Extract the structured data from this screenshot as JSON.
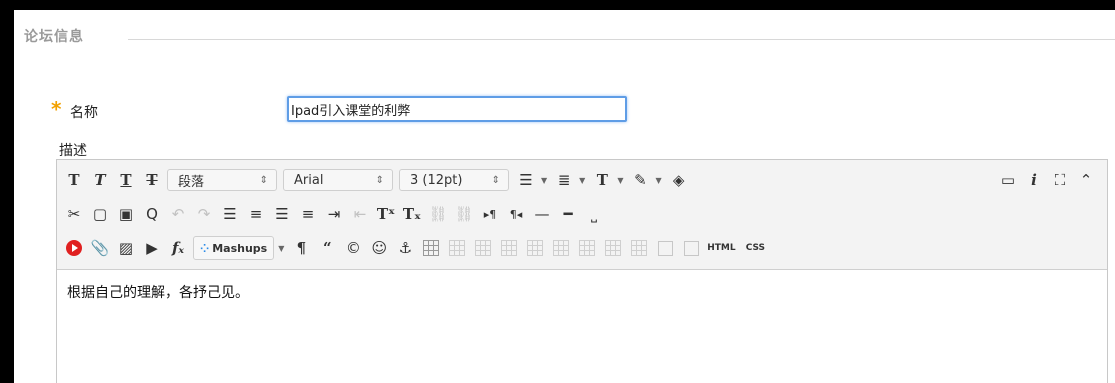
{
  "fieldset": {
    "title": "论坛信息"
  },
  "form": {
    "required_mark": "*",
    "name_label": "名称",
    "name_value": "Ipad引入课堂的利弊",
    "desc_label": "描述"
  },
  "toolbar": {
    "row1": {
      "format_select": "段落",
      "font_select": "Arial",
      "size_select": "3 (12pt)"
    },
    "row3": {
      "mashups_label": "Mashups",
      "html_label": "HTML",
      "css_label": "CSS"
    }
  },
  "editor": {
    "content": "根据自己的理解，各抒己见。"
  },
  "icons": {
    "row1_left": [
      "bold-t-icon",
      "italic-t-icon",
      "underline-t-icon",
      "strikethrough-t-icon"
    ],
    "row1_right": [
      "preview-icon",
      "info-icon",
      "fullscreen-icon",
      "collapse-icon"
    ],
    "colors": {
      "required": "#f2a100",
      "focus_border": "#5f9de6",
      "youtube": "#e02020"
    }
  }
}
